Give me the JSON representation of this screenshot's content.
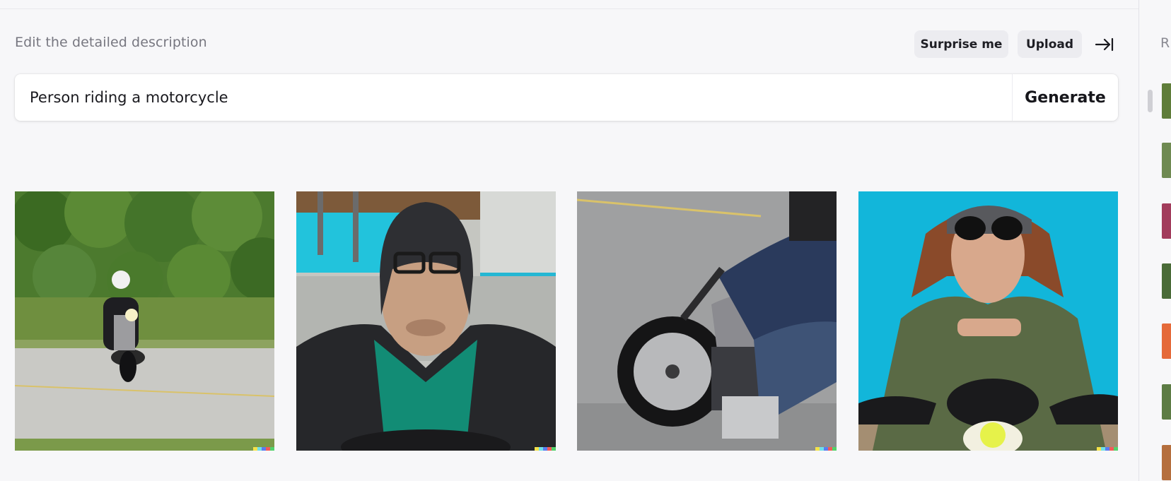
{
  "editor": {
    "hint": "Edit the detailed description",
    "surprise_label": "Surprise me",
    "upload_label": "Upload",
    "collapse_icon": "arrow-right-to-bar-icon",
    "prompt_value": "Person riding a motorcycle",
    "generate_label": "Generate"
  },
  "results": [
    {
      "name": "result-image-1",
      "subject": "rider-on-road-with-greenery"
    },
    {
      "name": "result-image-2",
      "subject": "man-with-helmet-and-glasses"
    },
    {
      "name": "result-image-3",
      "subject": "rider-on-cruiser-motorcycle"
    },
    {
      "name": "result-image-4",
      "subject": "woman-with-helmet-and-sunglasses"
    }
  ],
  "sidebar": {
    "title": "R"
  },
  "colors": {
    "background": "#f7f7f9",
    "pill": "#ececf0",
    "signature": [
      "#f4e34a",
      "#6fe0e8",
      "#5a7cf0",
      "#f25a5a",
      "#52d36b"
    ]
  }
}
